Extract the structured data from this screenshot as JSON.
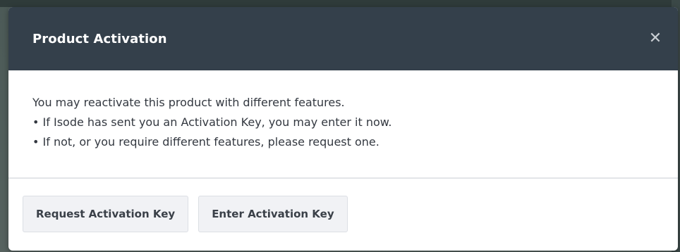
{
  "dialog": {
    "title": "Product Activation",
    "close_glyph": "✕",
    "message": "You may reactivate this product with different features.",
    "bullets": [
      "If Isode has sent you an Activation Key, you may enter it now.",
      "If not, or you require different features, please request one."
    ],
    "bullet_glyph": "•"
  },
  "footer": {
    "request_button": "Request Activation Key",
    "enter_button": "Enter Activation Key"
  },
  "colors": {
    "header_bg": "#34404b",
    "header_text": "#ffffff",
    "body_text": "#333840",
    "button_bg": "#f1f2f5"
  }
}
